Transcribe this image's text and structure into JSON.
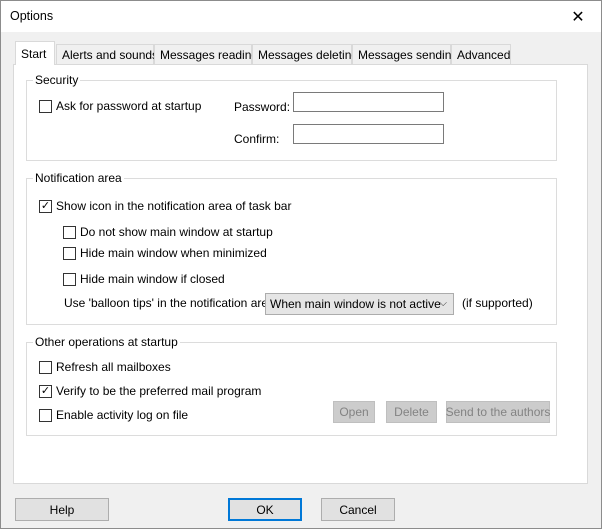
{
  "window": {
    "title": "Options",
    "close_symbol": "✕"
  },
  "tabs": [
    {
      "label": "Start",
      "active": true
    },
    {
      "label": "Alerts and sounds"
    },
    {
      "label": "Messages reading"
    },
    {
      "label": "Messages deleting"
    },
    {
      "label": "Messages sending"
    },
    {
      "label": "Advanced"
    }
  ],
  "security": {
    "legend": "Security",
    "ask_password": {
      "label": "Ask for password at startup",
      "checked": false
    },
    "password_label": "Password:",
    "password_value": "",
    "confirm_label": "Confirm:",
    "confirm_value": ""
  },
  "notification": {
    "legend": "Notification area",
    "show_icon": {
      "label": "Show icon in the notification area of task bar",
      "checked": true
    },
    "no_show_main": {
      "label": "Do not show main window at startup",
      "checked": false
    },
    "hide_minimized": {
      "label": "Hide main window when minimized",
      "checked": false
    },
    "hide_closed": {
      "label": "Hide main window if closed",
      "checked": false
    },
    "balloon_label": "Use 'balloon tips' in the notification area",
    "balloon_value": "When main window is not active",
    "balloon_note": "(if supported)"
  },
  "startup": {
    "legend": "Other operations at startup",
    "refresh": {
      "label": "Refresh all mailboxes",
      "checked": false
    },
    "verify": {
      "label": "Verify to be the preferred mail program",
      "checked": true
    },
    "activity_log": {
      "label": "Enable activity log on file",
      "checked": false
    },
    "open_label": "Open",
    "delete_label": "Delete",
    "send_label": "Send to the authors"
  },
  "footer": {
    "help_label": "Help",
    "ok_label": "OK",
    "cancel_label": "Cancel"
  },
  "check_glyph": "✓"
}
